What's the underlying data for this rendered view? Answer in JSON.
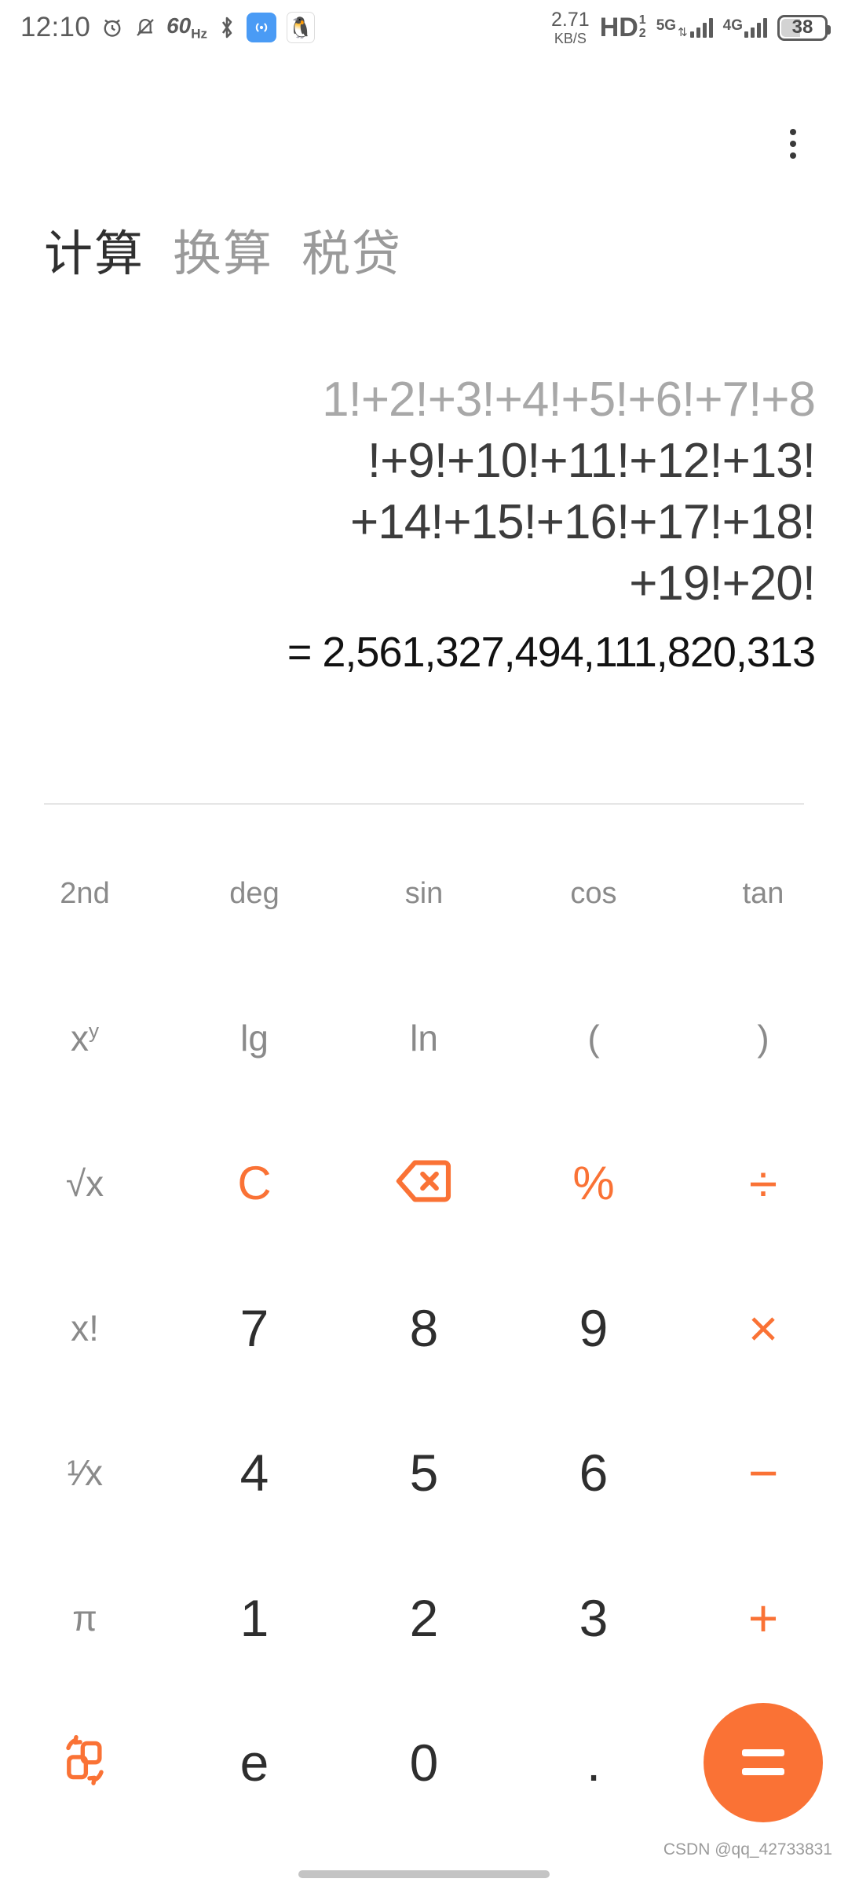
{
  "status_bar": {
    "time": "12:10",
    "alarm_icon": "alarm-clock-icon",
    "silent_icon": "bell-muted-icon",
    "refresh_rate": "60",
    "refresh_rate_unit": "Hz",
    "bluetooth_icon": "bluetooth-icon",
    "hotspot_icon": "hotspot-icon",
    "qq_icon": "qq-penguin-icon",
    "network_speed_value": "2.71",
    "network_speed_unit": "KB/S",
    "volte_label": "HD",
    "volte_sup": "1",
    "volte_sub": "2",
    "sim1_network": "5G",
    "sim2_network": "4G",
    "battery_level": "38"
  },
  "header": {
    "overflow_menu_label": "more-options"
  },
  "tabs": [
    {
      "label": "计算",
      "active": true
    },
    {
      "label": "换算",
      "active": false
    },
    {
      "label": "税贷",
      "active": false
    }
  ],
  "display": {
    "expression_lines": [
      "1!+2!+3!+4!+5!+6!+7!+8",
      "!+9!+10!+11!+12!+13!",
      "+14!+15!+16!+17!+18!",
      "+19!+20!"
    ],
    "result": "= 2,561,327,494,111,820,313"
  },
  "keypad": {
    "rows": [
      [
        {
          "label": "2nd",
          "name": "key-2nd",
          "style": "fn"
        },
        {
          "label": "deg",
          "name": "key-deg",
          "style": "fn"
        },
        {
          "label": "sin",
          "name": "key-sin",
          "style": "fn"
        },
        {
          "label": "cos",
          "name": "key-cos",
          "style": "fn"
        },
        {
          "label": "tan",
          "name": "key-tan",
          "style": "fn"
        }
      ],
      [
        {
          "label": "x",
          "sup": "y",
          "name": "key-power",
          "style": "fn-lg"
        },
        {
          "label": "lg",
          "name": "key-log10",
          "style": "fn-lg"
        },
        {
          "label": "ln",
          "name": "key-ln",
          "style": "fn-lg"
        },
        {
          "label": "(",
          "name": "key-paren-open",
          "style": "fn-lg"
        },
        {
          "label": ")",
          "name": "key-paren-close",
          "style": "fn-lg"
        }
      ],
      [
        {
          "label": "√x",
          "name": "key-sqrt",
          "style": "fn-lg"
        },
        {
          "label": "C",
          "name": "key-clear",
          "style": "op"
        },
        {
          "label": "",
          "name": "key-backspace",
          "style": "icon-backspace"
        },
        {
          "label": "%",
          "name": "key-percent",
          "style": "op"
        },
        {
          "label": "÷",
          "name": "key-divide",
          "style": "op-lg"
        }
      ],
      [
        {
          "label": "x!",
          "name": "key-factorial",
          "style": "fn-lg"
        },
        {
          "label": "7",
          "name": "key-7",
          "style": "num"
        },
        {
          "label": "8",
          "name": "key-8",
          "style": "num"
        },
        {
          "label": "9",
          "name": "key-9",
          "style": "num"
        },
        {
          "label": "×",
          "name": "key-multiply",
          "style": "op-lg"
        }
      ],
      [
        {
          "label": "¹⁄x",
          "name": "key-reciprocal",
          "style": "fn-lg"
        },
        {
          "label": "4",
          "name": "key-4",
          "style": "num"
        },
        {
          "label": "5",
          "name": "key-5",
          "style": "num"
        },
        {
          "label": "6",
          "name": "key-6",
          "style": "num"
        },
        {
          "label": "−",
          "name": "key-minus",
          "style": "op-lg"
        }
      ],
      [
        {
          "label": "π",
          "name": "key-pi",
          "style": "fn-lg"
        },
        {
          "label": "1",
          "name": "key-1",
          "style": "num"
        },
        {
          "label": "2",
          "name": "key-2",
          "style": "num"
        },
        {
          "label": "3",
          "name": "key-3",
          "style": "num"
        },
        {
          "label": "+",
          "name": "key-plus",
          "style": "op-lg"
        }
      ],
      [
        {
          "label": "",
          "name": "key-swap-mode",
          "style": "icon-swap"
        },
        {
          "label": "e",
          "name": "key-e",
          "style": "num"
        },
        {
          "label": "0",
          "name": "key-0",
          "style": "num"
        },
        {
          "label": ".",
          "name": "key-decimal",
          "style": "num"
        },
        {
          "label": "=",
          "name": "key-equals",
          "style": "equals"
        }
      ]
    ]
  },
  "footer": {
    "watermark": "CSDN @qq_42733831"
  },
  "colors": {
    "accent": "#fa7235",
    "text_primary": "#2e2e2e",
    "text_muted": "#8a8a8a"
  }
}
